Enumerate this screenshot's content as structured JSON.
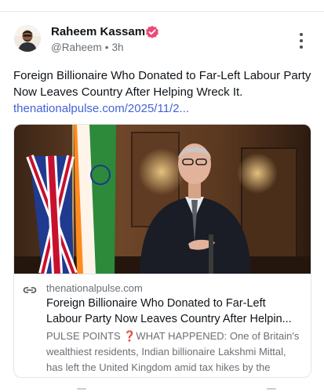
{
  "post": {
    "author": {
      "name": "Raheem Kassam",
      "handle": "@Raheem",
      "separator": "•",
      "time": "3h",
      "verified_color": "#e84b7a"
    },
    "text": "Foreign Billionaire Who Donated to Far-Left Labour Party Now Leaves Country After Helping Wreck It.",
    "link_text": "thenationalpulse.com/2025/11/2...",
    "link_color": "#4562d6"
  },
  "card": {
    "domain": "thenationalpulse.com",
    "title_line1": "Foreign Billionaire Who Donated to Far-Left",
    "title_line2": "Labour Party Now Leaves Country After Helpin...",
    "description_line1": "PULSE POINTS ❓WHAT HAPPENED: One of Britain's",
    "description_line2": "wealthiest residents, Indian billionaire Lakshmi Mittal,",
    "description_line3": "has left the United Kingdom amid tax hikes by the"
  },
  "icons": {
    "verified": "verified-badge-icon",
    "more": "more-vertical-icon",
    "link": "link-chain-icon"
  }
}
